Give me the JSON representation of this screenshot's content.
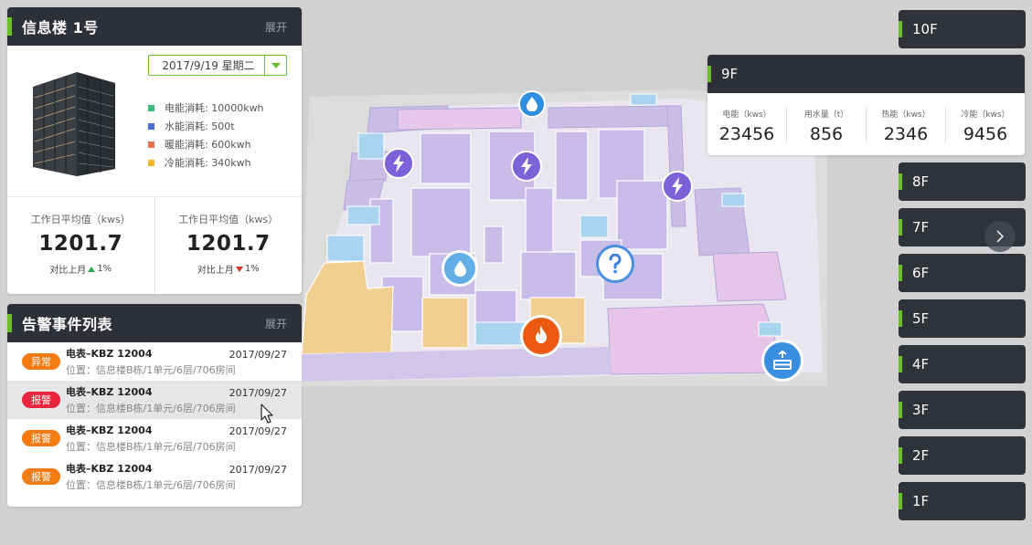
{
  "building": {
    "title": "信息楼 1号",
    "expand": "展开",
    "date": "2017/9/19  星期二",
    "legend": [
      {
        "label": "电能消耗:  10000kwh",
        "color": "#3dbd7d"
      },
      {
        "label": "水能消耗:  500t",
        "color": "#4a6fd1"
      },
      {
        "label": "暖能消耗:  600kwh",
        "color": "#e8704a"
      },
      {
        "label": "冷能消耗:  340kwh",
        "color": "#f2b428"
      }
    ],
    "stats": [
      {
        "label": "工作日平均值（kws）",
        "value": "1201.7",
        "compare": "对比上月",
        "pct": "1%",
        "trend": "up"
      },
      {
        "label": "工作日平均值（kws）",
        "value": "1201.7",
        "compare": "对比上月",
        "pct": "1%",
        "trend": "down"
      }
    ]
  },
  "alarms": {
    "title": "告警事件列表",
    "expand": "展开",
    "items": [
      {
        "badge": "异常",
        "badge_color": "#f47a12",
        "name": "电表–KBZ 12004",
        "location": "位置：信息楼B栋/1单元/6层/706房间",
        "date": "2017/09/27"
      },
      {
        "badge": "报警",
        "badge_color": "#e8253c",
        "name": "电表–KBZ 12004",
        "location": "位置：信息楼B栋/1单元/6层/706房间",
        "date": "2017/09/27"
      },
      {
        "badge": "报警",
        "badge_color": "#f47a12",
        "name": "电表–KBZ 12004",
        "location": "位置：信息楼B栋/1单元/6层/706房间",
        "date": "2017/09/27"
      },
      {
        "badge": "报警",
        "badge_color": "#f47a12",
        "name": "电表–KBZ 12004",
        "location": "位置：信息楼B栋/1单元/6层/706房间",
        "date": "2017/09/27"
      }
    ]
  },
  "floors": {
    "top": "10F",
    "active": {
      "label": "9F",
      "metrics": [
        {
          "label": "电能（kws）",
          "value": "23456"
        },
        {
          "label": "用水量（t）",
          "value": "856"
        },
        {
          "label": "热能（kws）",
          "value": "2346"
        },
        {
          "label": "冷能（kws）",
          "value": "9456"
        }
      ]
    },
    "rest": [
      "8F",
      "7F",
      "6F",
      "5F",
      "4F",
      "3F",
      "2F",
      "1F"
    ]
  },
  "map_icons": [
    {
      "name": "water-drop-icon"
    },
    {
      "name": "lightning-icon"
    },
    {
      "name": "lightning-icon"
    },
    {
      "name": "lightning-icon"
    },
    {
      "name": "water-drop-icon"
    },
    {
      "name": "question-mark-icon"
    },
    {
      "name": "fire-icon"
    },
    {
      "name": "elevator-icon"
    }
  ]
}
